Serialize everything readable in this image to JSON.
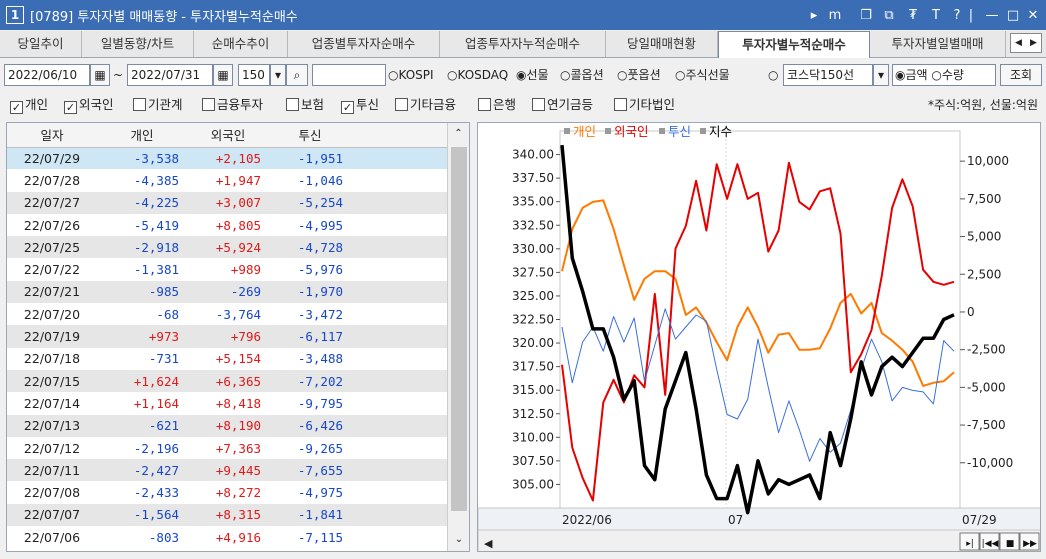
{
  "window": {
    "number": "1",
    "title": "[0789] 투자자별 매매동향 - 투자자별누적순매수",
    "controls": [
      "▸",
      "m",
      "❐",
      "⧉",
      "₮",
      "T",
      "?",
      "|",
      "—",
      "□",
      "✕"
    ]
  },
  "tabs": [
    "당일추이",
    "일별동향/차트",
    "순매수추이",
    "업종별투자자순매수",
    "업종투자자누적순매수",
    "당일매매현황",
    "투자자별누적순매수",
    "투자자별일별매매"
  ],
  "active_tab": 6,
  "tab_nav": [
    "◀",
    "▶"
  ],
  "filters": {
    "start_date": "2022/06/10",
    "tilde": "~",
    "end_date": "2022/07/31",
    "count": "150",
    "code": "",
    "market_options": [
      "KOSPI",
      "KOSDAQ",
      "선물",
      "콜옵션",
      "풋옵션",
      "주식선물",
      "코스닥150선"
    ],
    "market_selected": "선물",
    "amount_options": [
      "금액",
      "수량"
    ],
    "amount_selected": "금액",
    "query_button": "조회"
  },
  "investors": [
    {
      "label": "개인",
      "checked": true
    },
    {
      "label": "외국인",
      "checked": true
    },
    {
      "label": "기관계",
      "checked": false
    },
    {
      "label": "금융투자",
      "checked": false
    },
    {
      "label": "보험",
      "checked": false
    },
    {
      "label": "투신",
      "checked": true
    },
    {
      "label": "기타금융",
      "checked": false
    },
    {
      "label": "은행",
      "checked": false
    },
    {
      "label": "연기금등",
      "checked": false
    },
    {
      "label": "기타법인",
      "checked": false
    }
  ],
  "unit_note": "*주식:억원, 선물:억원",
  "table": {
    "headers": [
      "일자",
      "개인",
      "외국인",
      "투신"
    ],
    "rows": [
      [
        "22/07/29",
        "-3,538",
        "+2,105",
        "-1,951"
      ],
      [
        "22/07/28",
        "-4,385",
        "+1,947",
        "-1,046"
      ],
      [
        "22/07/27",
        "-4,225",
        "+3,007",
        "-5,254"
      ],
      [
        "22/07/26",
        "-5,419",
        "+8,805",
        "-4,995"
      ],
      [
        "22/07/25",
        "-2,918",
        "+5,924",
        "-4,728"
      ],
      [
        "22/07/22",
        "-1,381",
        "+989",
        "-5,976"
      ],
      [
        "22/07/21",
        "-985",
        "-269",
        "-1,970"
      ],
      [
        "22/07/20",
        "-68",
        "-3,764",
        "-3,472"
      ],
      [
        "22/07/19",
        "+973",
        "+796",
        "-6,117"
      ],
      [
        "22/07/18",
        "-731",
        "+5,154",
        "-3,488"
      ],
      [
        "22/07/15",
        "+1,624",
        "+6,365",
        "-7,202"
      ],
      [
        "22/07/14",
        "+1,164",
        "+8,418",
        "-9,795"
      ],
      [
        "22/07/13",
        "-621",
        "+8,190",
        "-6,426"
      ],
      [
        "22/07/12",
        "-2,196",
        "+7,363",
        "-9,265"
      ],
      [
        "22/07/11",
        "-2,427",
        "+9,445",
        "-7,655"
      ],
      [
        "22/07/08",
        "-2,433",
        "+8,272",
        "-4,975"
      ],
      [
        "22/07/07",
        "-1,564",
        "+8,315",
        "-1,841"
      ],
      [
        "22/07/06",
        "-803",
        "+4,916",
        "-7,115"
      ]
    ]
  },
  "chart": {
    "legend": [
      {
        "label": "개인",
        "color": "#ff7a00"
      },
      {
        "label": "외국인",
        "color": "#e60000"
      },
      {
        "label": "투신",
        "color": "#3a6fe0"
      },
      {
        "label": "지수",
        "color": "#000000"
      }
    ],
    "left_ticks": [
      "340.00",
      "337.50",
      "335.00",
      "332.50",
      "330.00",
      "327.50",
      "325.00",
      "322.50",
      "320.00",
      "317.50",
      "315.00",
      "312.50",
      "310.00",
      "307.50",
      "305.00"
    ],
    "right_ticks": [
      "10,000",
      "7,500",
      "5,000",
      "2,500",
      "0",
      "-2,500",
      "-5,000",
      "-7,500",
      "-10,000"
    ],
    "x_labels": [
      "2022/06",
      "07",
      "07/29"
    ]
  },
  "chart_data": {
    "type": "line",
    "left_ylim": [
      302.5,
      342.5
    ],
    "right_ylim": [
      -13000,
      12000
    ],
    "series": [
      {
        "name": "개인",
        "axis": "right",
        "values": [
          2700,
          5500,
          6900,
          7300,
          7400,
          5500,
          3100,
          800,
          2200,
          2700,
          2700,
          2200,
          -200,
          300,
          -700,
          -2000,
          -3200,
          -1000,
          300,
          -1000,
          -2700,
          -1500,
          -1400,
          -2500,
          -2500,
          -2400,
          -1100,
          600,
          1200,
          -100,
          600,
          -1400,
          -1900,
          -2500,
          -3300,
          -4900,
          -4700,
          -4600,
          -4000
        ]
      },
      {
        "name": "외국인",
        "axis": "right",
        "values": [
          -3500,
          -9000,
          -11000,
          -12500,
          -6000,
          -4500,
          -6000,
          -4200,
          -5000,
          1200,
          -5500,
          4200,
          5700,
          8700,
          5400,
          9800,
          7500,
          9800,
          7500,
          7900,
          4000,
          5400,
          9900,
          7300,
          6800,
          8000,
          8200,
          5200,
          -4000,
          -2800,
          -1200,
          2400,
          6900,
          8800,
          7000,
          2800,
          2000,
          1800,
          2000
        ]
      },
      {
        "name": "투신",
        "axis": "right",
        "values": [
          -1000,
          -4700,
          -2000,
          -1000,
          -2600,
          -300,
          -2000,
          -400,
          -4600,
          -2200,
          200,
          -1800,
          -1000,
          -200,
          -600,
          -3800,
          -6800,
          -7100,
          -5800,
          -1800,
          -5000,
          -8000,
          -5900,
          -7800,
          -9900,
          -8400,
          -9300,
          -8700,
          -6500,
          -3800,
          -1800,
          -3300,
          -5900,
          -5000,
          -5200,
          -5300,
          -6100,
          -1900,
          -2600
        ]
      },
      {
        "name": "지수",
        "axis": "left",
        "values": [
          341,
          329,
          325.5,
          321.5,
          321.5,
          318.5,
          314,
          316,
          307,
          305.5,
          313,
          316,
          319,
          313,
          306,
          303.5,
          303.5,
          307,
          302,
          307.5,
          304,
          305.5,
          305,
          305.5,
          306,
          303.5,
          310.5,
          307,
          312,
          318,
          314.5,
          317.5,
          318.5,
          317.5,
          319,
          320.5,
          320.5,
          322.5,
          323
        ]
      }
    ]
  }
}
